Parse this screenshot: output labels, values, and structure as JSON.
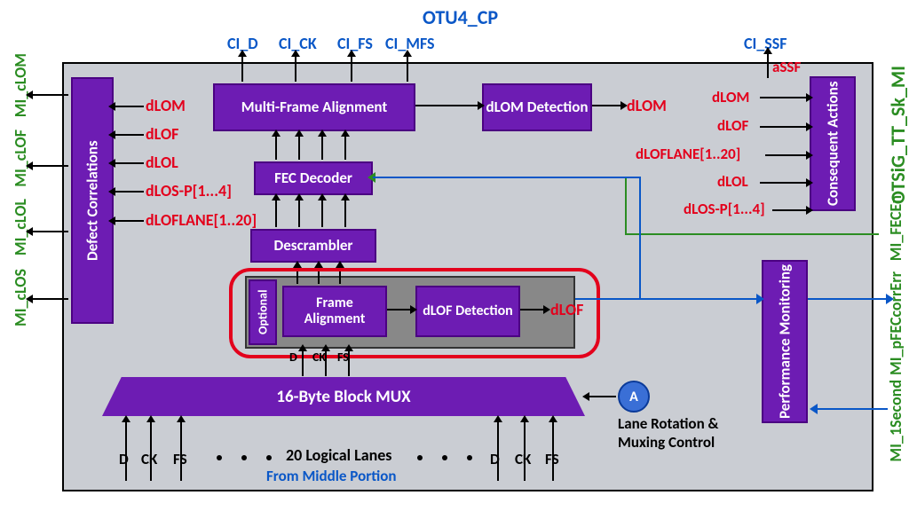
{
  "title": "OTU4_CP",
  "sidebar_right": "OTSiG_TT_Sk_MI",
  "left_outputs": [
    "MI_cLOS",
    "MI_cLOL",
    "MI_cLOF",
    "MI_cLOM"
  ],
  "right_mi": [
    "MI_FECEn",
    "MI_pFECcorrErr",
    "MI_1Second"
  ],
  "top_ci": [
    "CI_D",
    "CI_CK",
    "CI_FS",
    "CI_MFS"
  ],
  "ci_ssf": "CI_SSF",
  "a_ssf": "aSSF",
  "defects_left": [
    "dLOM",
    "dLOF",
    "dLOL",
    "dLOS-P[1...4]",
    "dLOFLANE[1..20]"
  ],
  "defects_right": [
    "dLOM",
    "dLOF",
    "dLOFLANE[1..20]",
    "dLOL",
    "dLOS-P[1...4]"
  ],
  "blocks": {
    "defect_corr": "Defect Correlations",
    "mfa": "Multi-Frame Alignment",
    "dlom": "dLOM Detection",
    "fec": "FEC Decoder",
    "descr": "Descrambler",
    "fa": "Frame Alignment",
    "dlof_det": "dLOF Detection",
    "optional": "Optional",
    "mux": "16-Byte Block MUX",
    "perf": "Performance Monitoring",
    "conseq": "Consequent Actions"
  },
  "right_defect": "dLOM",
  "dlof_out": "dLOF",
  "circle": "A",
  "lane_ctrl": "Lane Rotation & Muxing Control",
  "lanes_lbl": "20 Logical Lanes",
  "from_mid": "From Middle Portion",
  "lanes_a": [
    "D",
    "CK",
    "FS"
  ],
  "lanes_b": [
    "D",
    "CK",
    "FS"
  ],
  "mux_sub": [
    "D",
    "CK",
    "FS"
  ]
}
